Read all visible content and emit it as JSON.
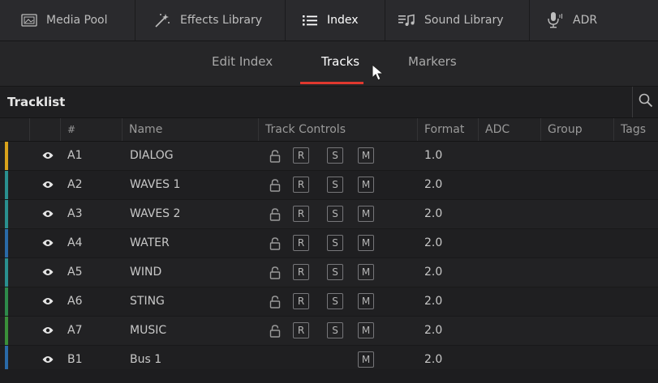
{
  "topbar": {
    "items": [
      {
        "label": "Media Pool",
        "icon": "media-pool-icon",
        "active": false
      },
      {
        "label": "Effects Library",
        "icon": "magic-wand-icon",
        "active": false
      },
      {
        "label": "Index",
        "icon": "list-icon",
        "active": true
      },
      {
        "label": "Sound Library",
        "icon": "sound-library-icon",
        "active": false
      },
      {
        "label": "ADR",
        "icon": "microphone-icon",
        "active": false
      }
    ]
  },
  "subtabs": [
    "Edit Index",
    "Tracks",
    "Markers"
  ],
  "active_subtab": "Tracks",
  "tracklist": {
    "title": "Tracklist",
    "columns": [
      "#",
      "Name",
      "Track Controls",
      "Format",
      "ADC",
      "Group",
      "Tags"
    ],
    "rows": [
      {
        "id": "A1",
        "name": "DIALOG",
        "format": "1.0",
        "controls": [
          "R",
          "S",
          "M"
        ],
        "color": "#d9a21b"
      },
      {
        "id": "A2",
        "name": "WAVES 1",
        "format": "2.0",
        "controls": [
          "R",
          "S",
          "M"
        ],
        "color": "#2a8f8f"
      },
      {
        "id": "A3",
        "name": "WAVES 2",
        "format": "2.0",
        "controls": [
          "R",
          "S",
          "M"
        ],
        "color": "#2a8f8f"
      },
      {
        "id": "A4",
        "name": "WATER",
        "format": "2.0",
        "controls": [
          "R",
          "S",
          "M"
        ],
        "color": "#2a6aa8"
      },
      {
        "id": "A5",
        "name": "WIND",
        "format": "2.0",
        "controls": [
          "R",
          "S",
          "M"
        ],
        "color": "#2a8f8f"
      },
      {
        "id": "A6",
        "name": "STING",
        "format": "2.0",
        "controls": [
          "R",
          "S",
          "M"
        ],
        "color": "#2e8a4a"
      },
      {
        "id": "A7",
        "name": "MUSIC",
        "format": "2.0",
        "controls": [
          "R",
          "S",
          "M"
        ],
        "color": "#3a8f3a"
      },
      {
        "id": "B1",
        "name": "Bus 1",
        "format": "2.0",
        "controls": [
          "M"
        ],
        "color": "#2a6aa8"
      }
    ]
  },
  "colors": {
    "accent": "#e0382f"
  }
}
